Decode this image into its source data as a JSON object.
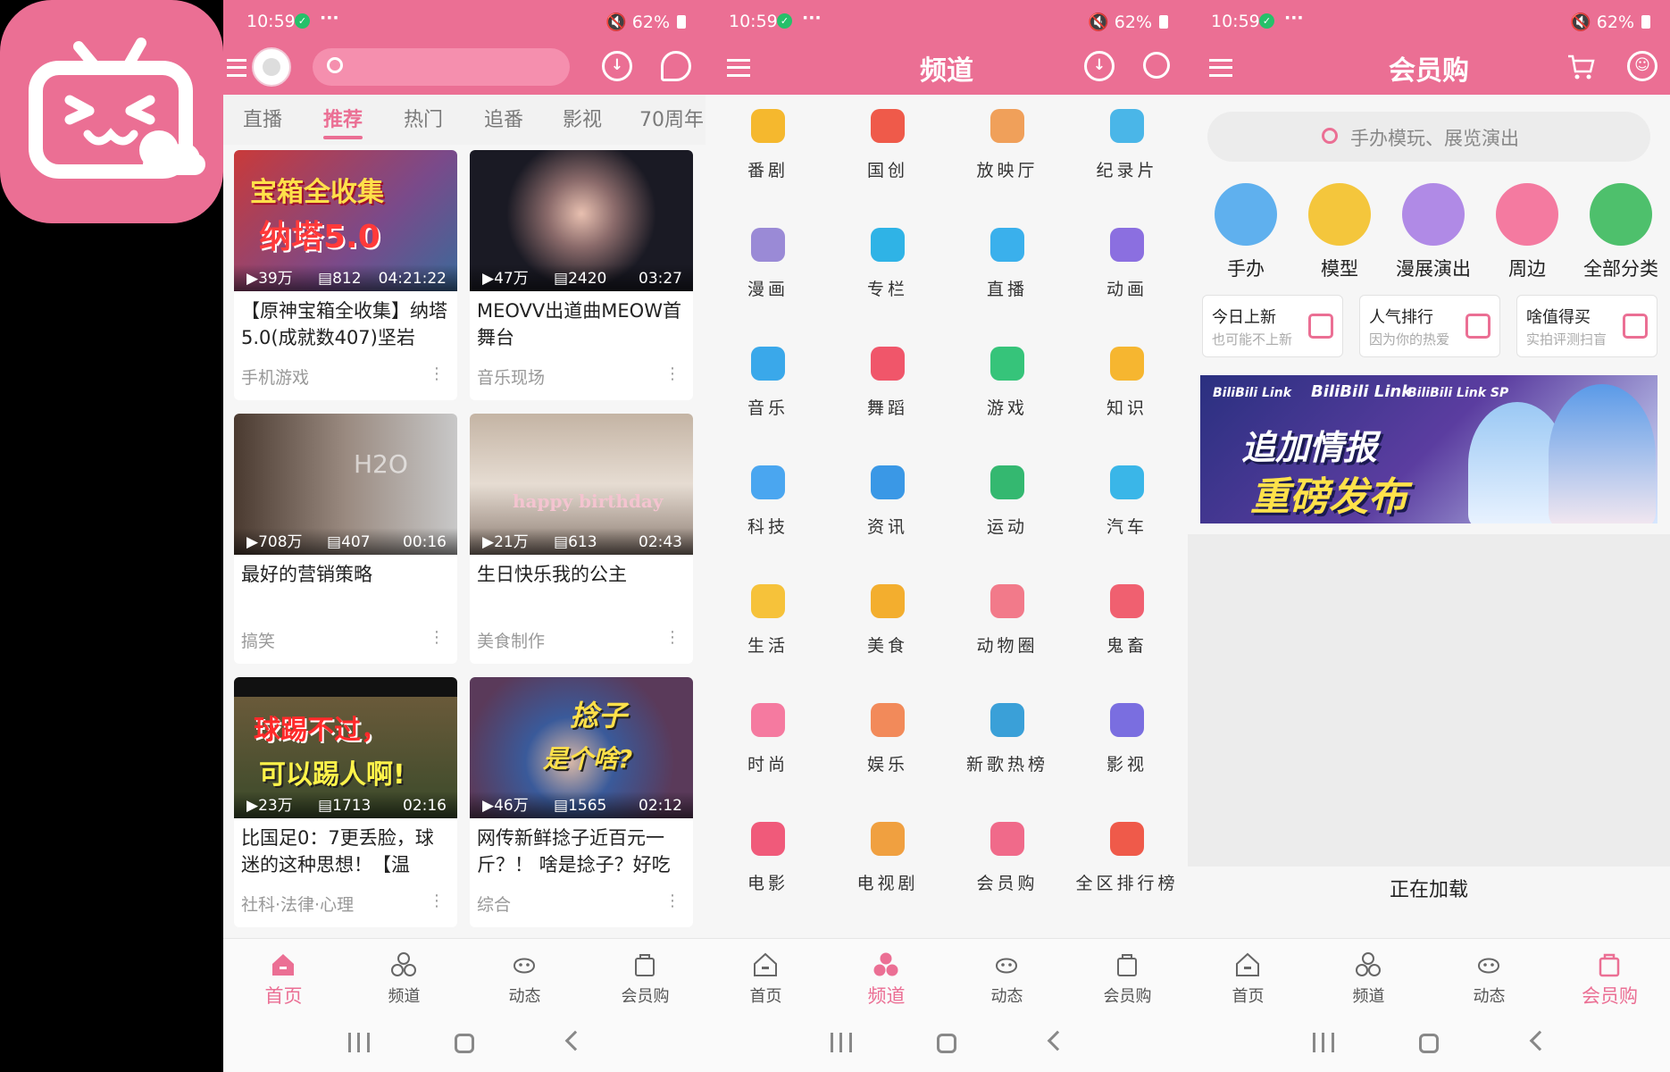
{
  "status": {
    "time": "10:59",
    "battery": "62%"
  },
  "screen1": {
    "tabs": [
      "直播",
      "推荐",
      "热门",
      "追番",
      "影视",
      "70周年"
    ],
    "active_tab": "推荐",
    "cards": [
      {
        "views": "39万",
        "danmaku": "812",
        "duration": "04:21:22",
        "title": "【原神宝箱全收集】纳塔5.0(成就数407)坚岩",
        "category": "手机游戏",
        "overlay": [
          "宝箱全收集",
          "纳塔5.0"
        ]
      },
      {
        "views": "47万",
        "danmaku": "2420",
        "duration": "03:27",
        "title": "MEOVV出道曲MEOW首舞台",
        "category": "音乐现场",
        "overlay": []
      },
      {
        "views": "708万",
        "danmaku": "407",
        "duration": "00:16",
        "title": "最好的营销策略",
        "category": "搞笑",
        "overlay": [
          "H2O"
        ]
      },
      {
        "views": "21万",
        "danmaku": "613",
        "duration": "02:43",
        "title": "生日快乐我的公主",
        "category": "美食制作",
        "overlay": [
          "happy birthday"
        ]
      },
      {
        "views": "23万",
        "danmaku": "1713",
        "duration": "02:16",
        "title": "比国足0：7更丢脸，球迷的这种思想！【温",
        "category": "社科·法律·心理",
        "overlay": [
          "球踢不过，",
          "可以踢人啊!"
        ]
      },
      {
        "views": "46万",
        "danmaku": "1565",
        "duration": "02:12",
        "title": "网传新鲜捻子近百元一斤？！ 啥是捻子？好吃",
        "category": "综合",
        "overlay": [
          "捻子",
          "是个啥?"
        ]
      }
    ]
  },
  "screen2": {
    "title": "频道",
    "channels": [
      {
        "label": "番剧",
        "color": "#f5b82e"
      },
      {
        "label": "国创",
        "color": "#ef5a4a"
      },
      {
        "label": "放映厅",
        "color": "#f0a05a"
      },
      {
        "label": "纪录片",
        "color": "#4ab6e8"
      },
      {
        "label": "漫画",
        "color": "#9a8ad6"
      },
      {
        "label": "专栏",
        "color": "#2fb3e6"
      },
      {
        "label": "直播",
        "color": "#3ab0ec"
      },
      {
        "label": "动画",
        "color": "#8b6fe0"
      },
      {
        "label": "音乐",
        "color": "#3aa8ea"
      },
      {
        "label": "舞蹈",
        "color": "#f0566a"
      },
      {
        "label": "游戏",
        "color": "#36c47a"
      },
      {
        "label": "知识",
        "color": "#f6b630"
      },
      {
        "label": "科技",
        "color": "#4aa6f0"
      },
      {
        "label": "资讯",
        "color": "#3a98e6"
      },
      {
        "label": "运动",
        "color": "#34b870"
      },
      {
        "label": "汽车",
        "color": "#3ab6e8"
      },
      {
        "label": "生活",
        "color": "#f6c23a"
      },
      {
        "label": "美食",
        "color": "#f3ae2e"
      },
      {
        "label": "动物圈",
        "color": "#f27a8a"
      },
      {
        "label": "鬼畜",
        "color": "#f06070"
      },
      {
        "label": "时尚",
        "color": "#f57aa0"
      },
      {
        "label": "娱乐",
        "color": "#f28a5a"
      },
      {
        "label": "新歌热榜",
        "color": "#3aa0d8"
      },
      {
        "label": "影视",
        "color": "#7a6ee0"
      },
      {
        "label": "电影",
        "color": "#f05a7a"
      },
      {
        "label": "电视剧",
        "color": "#f0a040"
      },
      {
        "label": "会员购",
        "color": "#f06a8a"
      },
      {
        "label": "全区排行榜",
        "color": "#ef5a4a"
      }
    ]
  },
  "screen3": {
    "title": "会员购",
    "search_placeholder": "手办模玩、展览演出",
    "categories": [
      {
        "label": "手办",
        "color": "#5fb0ee"
      },
      {
        "label": "模型",
        "color": "#f4c63c"
      },
      {
        "label": "漫展演出",
        "color": "#b08ae6"
      },
      {
        "label": "周边",
        "color": "#f47aa0"
      },
      {
        "label": "全部分类",
        "color": "#4ec06c"
      }
    ],
    "quick": [
      {
        "title": "今日上新",
        "sub": "也可能不上新",
        "color": "#eb6f94"
      },
      {
        "title": "人气排行",
        "sub": "因为你的热爱",
        "color": "#eb6f94"
      },
      {
        "title": "啥值得买",
        "sub": "实拍评测扫盲",
        "color": "#eb6f94"
      }
    ],
    "banner": {
      "logos": [
        "BiliBili Link",
        "BiliBili Link",
        "BiliBili Link SP"
      ],
      "headline1": "追加情报",
      "headline2": "重磅发布"
    },
    "loading": "正在加载"
  },
  "nav": {
    "items": [
      "首页",
      "频道",
      "动态",
      "会员购"
    ]
  },
  "colors": {
    "brand": "#eb6f94"
  }
}
